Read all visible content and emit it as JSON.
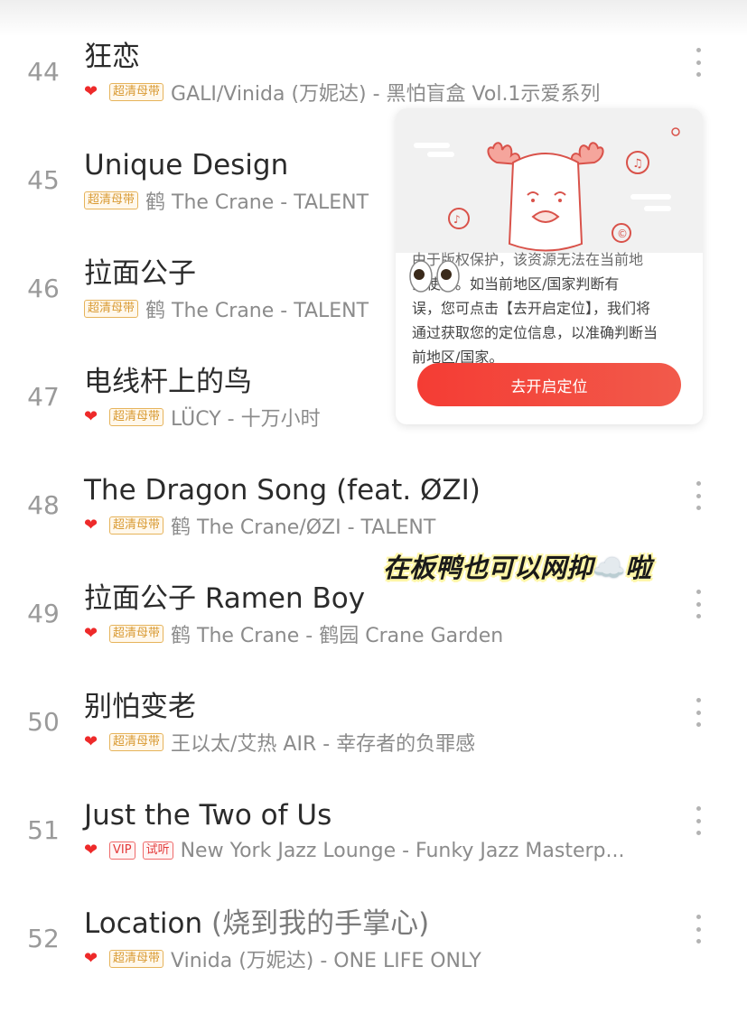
{
  "songs": [
    {
      "num": "44",
      "title": "狂恋",
      "subtitle": "",
      "liked": true,
      "tags": [
        "超清母带"
      ],
      "artist": "GALI/Vinida (万妮达) - 黑怕盲盒 Vol.1示爱系列",
      "more": true
    },
    {
      "num": "45",
      "title": "Unique Design",
      "subtitle": "",
      "liked": false,
      "tags": [
        "超清母带"
      ],
      "artist": "鹤 The Crane - TALENT",
      "more": false
    },
    {
      "num": "46",
      "title": "拉面公子",
      "subtitle": "",
      "liked": false,
      "tags": [
        "超清母带"
      ],
      "artist": "鹤 The Crane - TALENT",
      "more": false
    },
    {
      "num": "47",
      "title": "电线杆上的鸟",
      "subtitle": "",
      "liked": true,
      "tags": [
        "超清母带"
      ],
      "artist": "LÜCY - 十万小时",
      "more": false
    },
    {
      "num": "48",
      "title": "The Dragon Song (feat. ØZI)",
      "subtitle": "",
      "liked": true,
      "tags": [
        "超清母带"
      ],
      "artist": "鹤 The Crane/ØZI - TALENT",
      "more": true
    },
    {
      "num": "49",
      "title": "拉面公子 Ramen Boy",
      "subtitle": "",
      "liked": true,
      "tags": [
        "超清母带"
      ],
      "artist": "鹤 The Crane - 鹤园 Crane Garden",
      "more": true
    },
    {
      "num": "50",
      "title": "别怕变老",
      "subtitle": "",
      "liked": true,
      "tags": [
        "超清母带"
      ],
      "artist": "王以太/艾热 AIR - 幸存者的负罪感",
      "more": true
    },
    {
      "num": "51",
      "title": "Just the Two of Us",
      "subtitle": "",
      "liked": true,
      "tags": [
        "VIP",
        "试听"
      ],
      "artist": "New York Jazz Lounge - Funky Jazz Masterp...",
      "more": true
    },
    {
      "num": "52",
      "title": "Location",
      "subtitle": "(烧到我的手掌心)",
      "liked": true,
      "tags": [
        "超清母带"
      ],
      "artist": "Vinida (万妮达) - ONE LIFE ONLY",
      "more": true
    }
  ],
  "popup": {
    "line1": "由于版权保护，该资源无法在当前地",
    "line2": "区使用。如当前地区/国家判断有",
    "line3": "误，您可点击【去开启定位】，我们将",
    "line4": "通过获取您的定位信息，以准确判断当",
    "line5": "前地区/国家。",
    "button": "去开启定位"
  },
  "caption": {
    "before": "在板鸭也可以网抑",
    "cloud": "☁️",
    "after": "啦"
  },
  "colors": {
    "accent": "#f43c34",
    "tag": "#d99a33",
    "heart": "#ee2a2a"
  }
}
